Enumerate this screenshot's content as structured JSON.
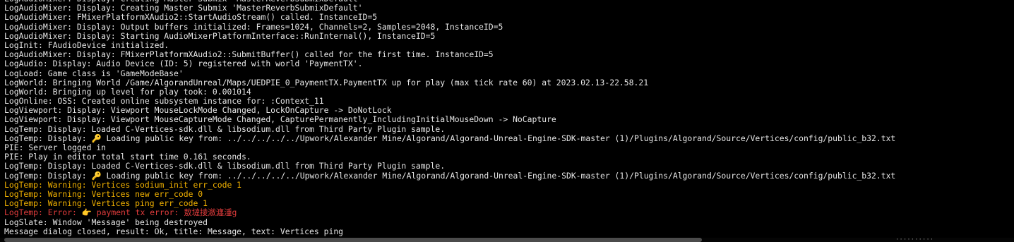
{
  "console": {
    "lines": [
      {
        "text": "LogAudioMixer: Display: Creating Master Submix 'MasterReverbSubmixDefault'",
        "level": "info"
      },
      {
        "text": "LogAudioMixer: Display: Creating Master Submix 'MasterReverbSubmixDefault'",
        "level": "info"
      },
      {
        "text": "LogAudioMixer: FMixerPlatformXAudio2::StartAudioStream() called. InstanceID=5",
        "level": "info"
      },
      {
        "text": "LogAudioMixer: Display: Output buffers initialized: Frames=1024, Channels=2, Samples=2048, InstanceID=5",
        "level": "info"
      },
      {
        "text": "LogAudioMixer: Display: Starting AudioMixerPlatformInterface::RunInternal(), InstanceID=5",
        "level": "info"
      },
      {
        "text": "LogInit: FAudioDevice initialized.",
        "level": "info"
      },
      {
        "text": "LogAudioMixer: Display: FMixerPlatformXAudio2::SubmitBuffer() called for the first time. InstanceID=5",
        "level": "info"
      },
      {
        "text": "LogAudio: Display: Audio Device (ID: 5) registered with world 'PaymentTX'.",
        "level": "info"
      },
      {
        "text": "LogLoad: Game class is 'GameModeBase'",
        "level": "info"
      },
      {
        "text": "LogWorld: Bringing World /Game/AlgorandUnreal/Maps/UEDPIE_0_PaymentTX.PaymentTX up for play (max tick rate 60) at 2023.02.13-22.58.21",
        "level": "info"
      },
      {
        "text": "LogWorld: Bringing up level for play took: 0.001014",
        "level": "info"
      },
      {
        "text": "LogOnline: OSS: Created online subsystem instance for: :Context_11",
        "level": "info"
      },
      {
        "text": "LogViewport: Display: Viewport MouseLockMode Changed, LockOnCapture -> DoNotLock",
        "level": "info"
      },
      {
        "text": "LogViewport: Display: Viewport MouseCaptureMode Changed, CapturePermanently_IncludingInitialMouseDown -> NoCapture",
        "level": "info"
      },
      {
        "text": "LogTemp: Display: Loaded C-Vertices-sdk.dll & libsodium.dll from Third Party Plugin sample.",
        "level": "info"
      },
      {
        "text": "LogTemp: Display: 🔑 Loading public key from: ../../../../../Upwork/Alexander Mine/Algorand/Algorand-Unreal-Engine-SDK-master (1)/Plugins/Algorand/Source/Vertices/config/public_b32.txt",
        "level": "info"
      },
      {
        "text": "PIE: Server logged in",
        "level": "info"
      },
      {
        "text": "PIE: Play in editor total start time 0.161 seconds.",
        "level": "info"
      },
      {
        "text": "LogTemp: Display: Loaded C-Vertices-sdk.dll & libsodium.dll from Third Party Plugin sample.",
        "level": "info"
      },
      {
        "text": "LogTemp: Display: 🔑 Loading public key from: ../../../../../Upwork/Alexander Mine/Algorand/Algorand-Unreal-Engine-SDK-master (1)/Plugins/Algorand/Source/Vertices/config/public_b32.txt",
        "level": "info"
      },
      {
        "text": "LogTemp: Warning: Vertices sodium_init err_code 1",
        "level": "warning"
      },
      {
        "text": "LogTemp: Warning: Vertices new err_code 0",
        "level": "warning"
      },
      {
        "text": "LogTemp: Warning: Vertices ping err_code 1",
        "level": "warning"
      },
      {
        "text": "LogTemp: Error: 👉 payment tx error: 敖墶掕瀲瀍湩g",
        "level": "error"
      },
      {
        "text": "LogSlate: Window 'Message' being destroyed",
        "level": "info"
      },
      {
        "text": "Message dialog closed, result: Ok, title: Message, text: Vertices ping",
        "level": "info"
      }
    ],
    "corner_text": "··········"
  },
  "colors": {
    "background": "#000000",
    "info_text": "#e6e6e6",
    "warning_text": "#f2b200",
    "error_text": "#e23c3c",
    "scrollbar_thumb": "#4b4b4b"
  }
}
